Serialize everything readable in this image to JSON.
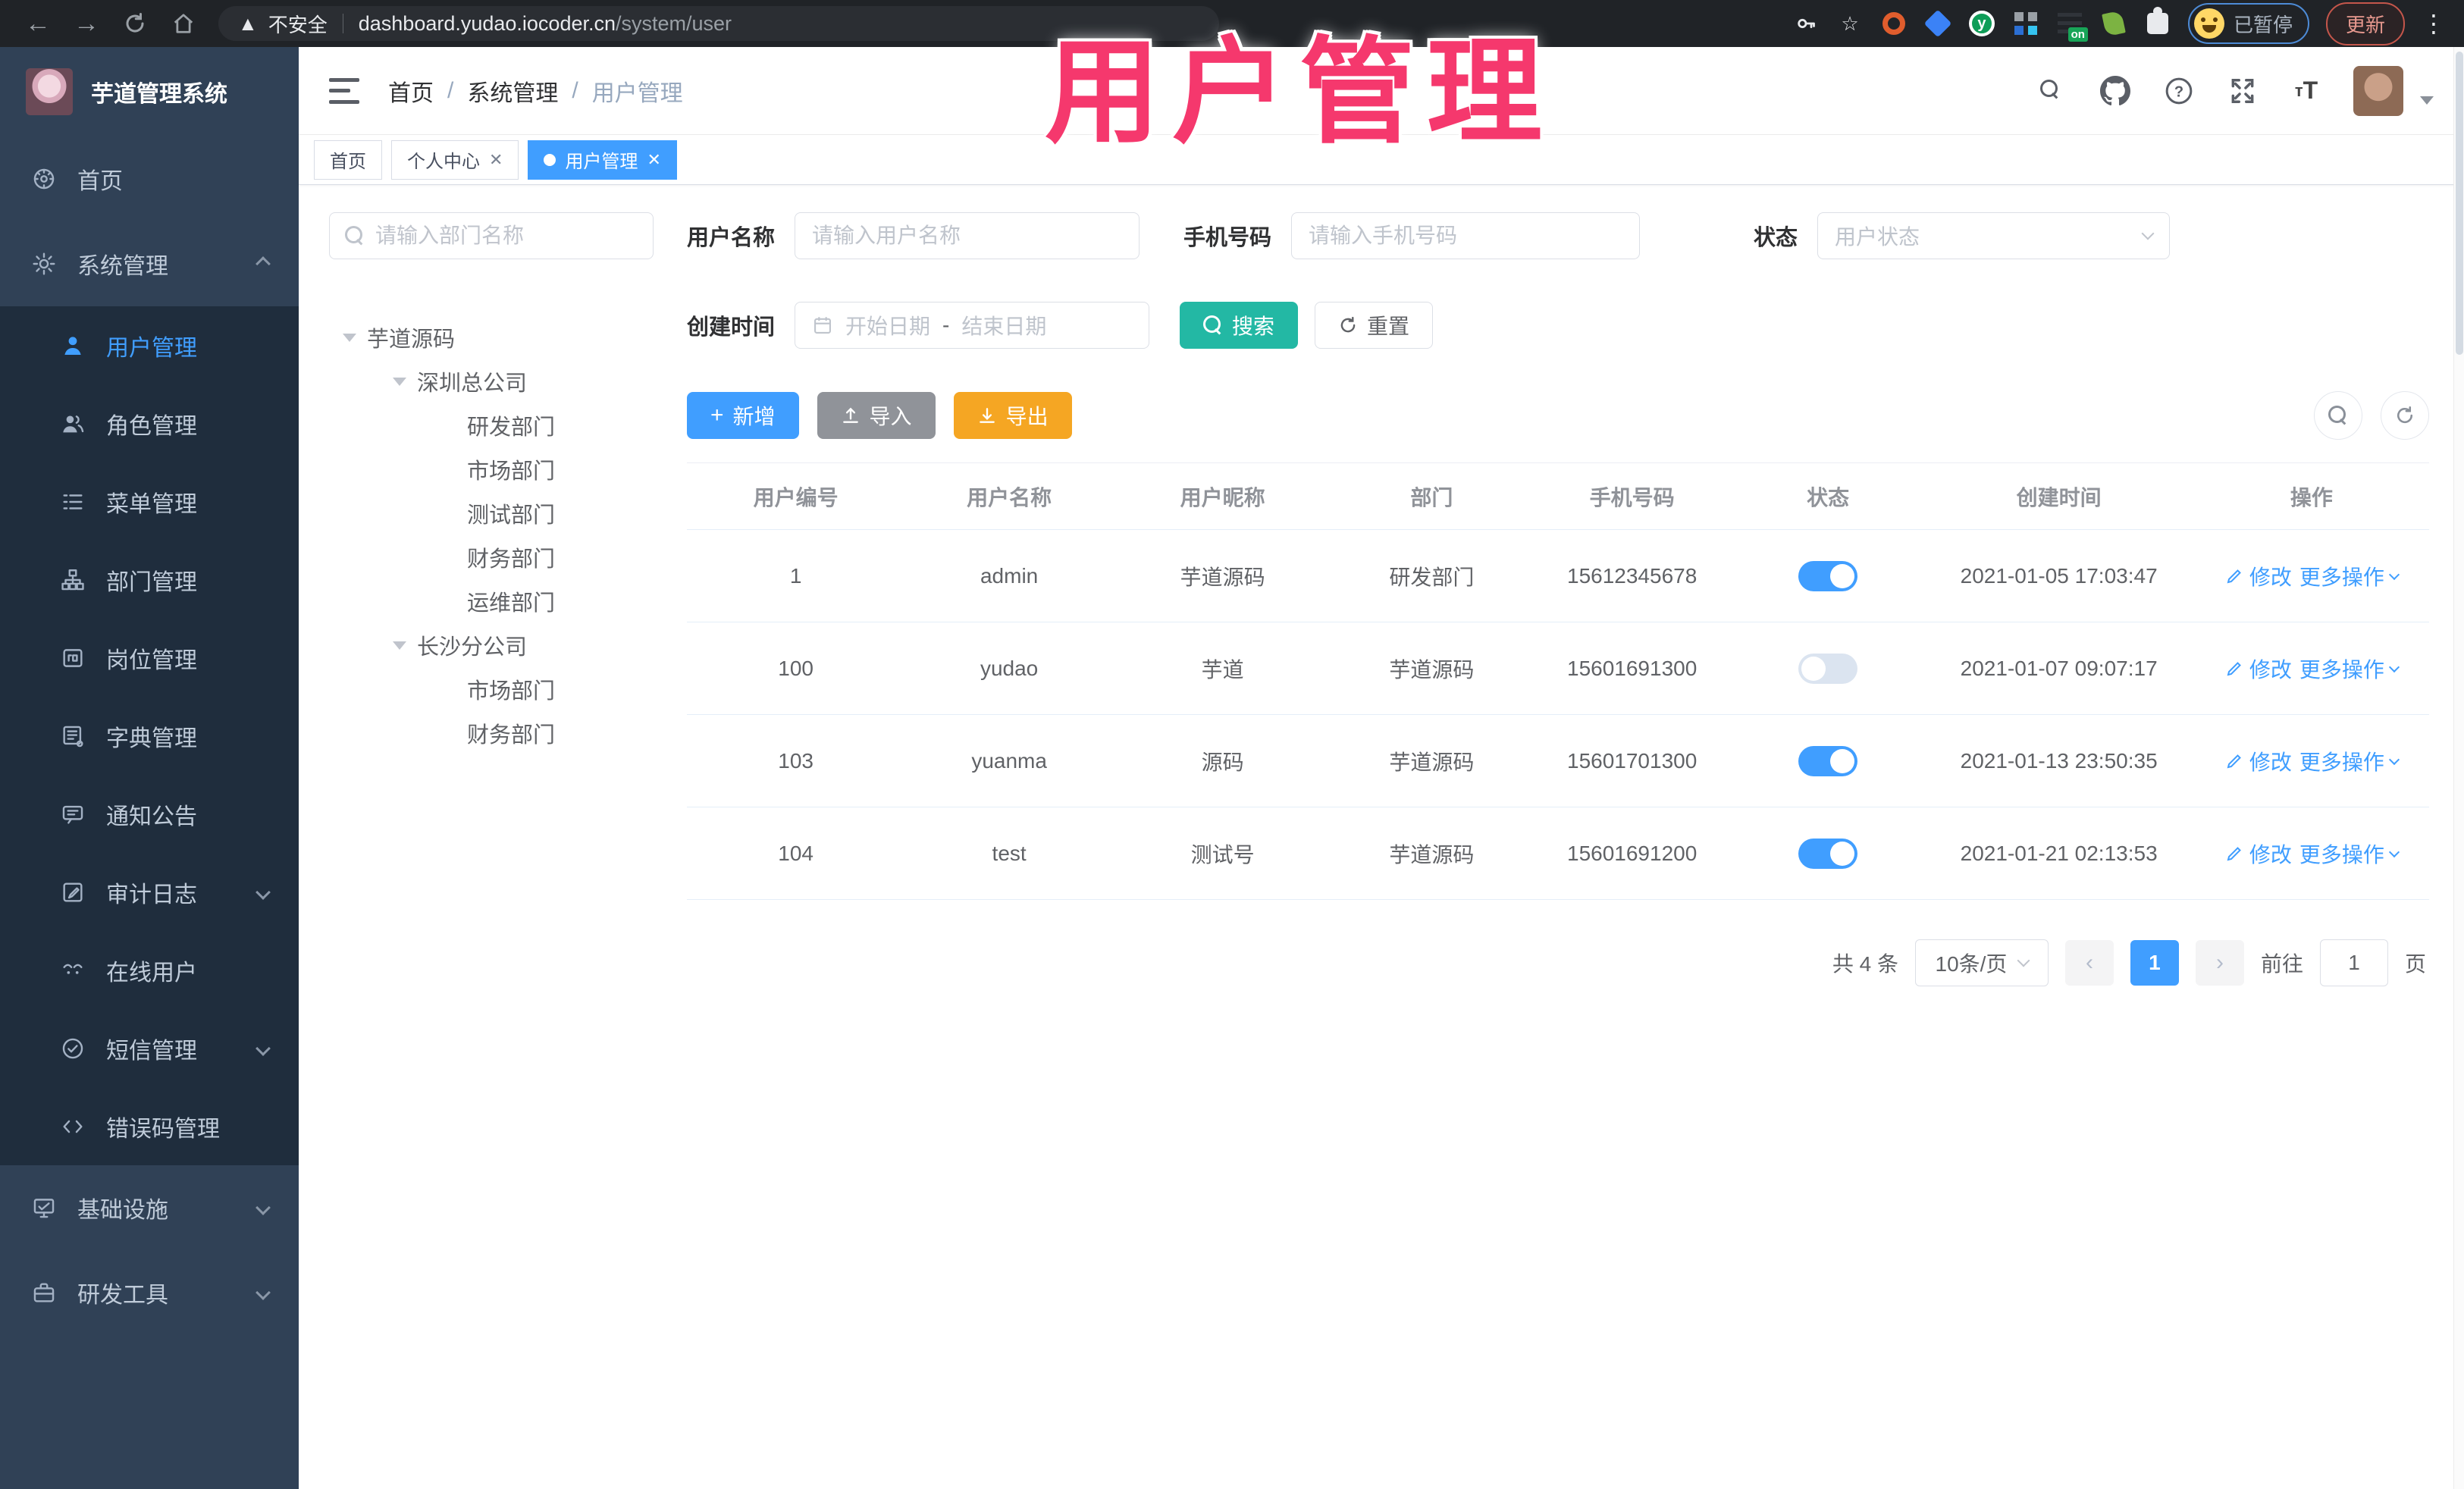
{
  "browser": {
    "security_warning": "不安全",
    "url_host": "dashboard.yudao.iocoder.cn",
    "url_path": "/system/user",
    "profile_status": "已暂停",
    "update_label": "更新"
  },
  "watermark": {
    "text": "用户管理",
    "color": "#f5386d"
  },
  "sidebar": {
    "logo_title": "芋道管理系统",
    "menu": [
      {
        "label": "首页",
        "icon": "dashboard-icon"
      },
      {
        "label": "系统管理",
        "icon": "gear-icon",
        "chevron": "up",
        "children": [
          {
            "label": "用户管理",
            "icon": "user-icon",
            "active": true
          },
          {
            "label": "角色管理",
            "icon": "roles-icon"
          },
          {
            "label": "菜单管理",
            "icon": "menu-list-icon"
          },
          {
            "label": "部门管理",
            "icon": "org-tree-icon"
          },
          {
            "label": "岗位管理",
            "icon": "post-badge-icon"
          },
          {
            "label": "字典管理",
            "icon": "dictionary-icon"
          },
          {
            "label": "通知公告",
            "icon": "announcement-icon"
          },
          {
            "label": "审计日志",
            "icon": "audit-log-icon",
            "chevron": "down"
          },
          {
            "label": "在线用户",
            "icon": "online-user-icon"
          },
          {
            "label": "短信管理",
            "icon": "sms-icon",
            "chevron": "down"
          },
          {
            "label": "错误码管理",
            "icon": "error-code-icon"
          }
        ]
      },
      {
        "label": "基础设施",
        "icon": "infrastructure-icon",
        "chevron": "down"
      },
      {
        "label": "研发工具",
        "icon": "dev-tools-icon",
        "chevron": "down"
      }
    ]
  },
  "header": {
    "breadcrumb": [
      "首页",
      "系统管理",
      "用户管理"
    ]
  },
  "tabs": [
    {
      "label": "首页",
      "closable": false,
      "active": false
    },
    {
      "label": "个人中心",
      "closable": true,
      "active": false
    },
    {
      "label": "用户管理",
      "closable": true,
      "active": true
    }
  ],
  "tree": {
    "search_placeholder": "请输入部门名称",
    "nodes": [
      {
        "label": "芋道源码",
        "level": 0,
        "caret": true
      },
      {
        "label": "深圳总公司",
        "level": 1,
        "caret": true
      },
      {
        "label": "研发部门",
        "level": 2
      },
      {
        "label": "市场部门",
        "level": 2
      },
      {
        "label": "测试部门",
        "level": 2
      },
      {
        "label": "财务部门",
        "level": 2
      },
      {
        "label": "运维部门",
        "level": 2
      },
      {
        "label": "长沙分公司",
        "level": 1,
        "caret": true
      },
      {
        "label": "市场部门",
        "level": 2
      },
      {
        "label": "财务部门",
        "level": 2
      }
    ]
  },
  "filters": {
    "username_label": "用户名称",
    "username_placeholder": "请输入用户名称",
    "mobile_label": "手机号码",
    "mobile_placeholder": "请输入手机号码",
    "status_label": "状态",
    "status_placeholder": "用户状态",
    "create_time_label": "创建时间",
    "date_start_placeholder": "开始日期",
    "date_separator": "-",
    "date_end_placeholder": "结束日期",
    "search_label": "搜索",
    "reset_label": "重置"
  },
  "toolbar": {
    "add_label": "新增",
    "import_label": "导入",
    "export_label": "导出"
  },
  "table": {
    "columns": [
      "用户编号",
      "用户名称",
      "用户昵称",
      "部门",
      "手机号码",
      "状态",
      "创建时间",
      "操作"
    ],
    "action_edit": "修改",
    "action_more": "更多操作",
    "rows": [
      {
        "id": "1",
        "username": "admin",
        "nickname": "芋道源码",
        "dept": "研发部门",
        "mobile": "15612345678",
        "status_on": true,
        "created": "2021-01-05 17:03:47"
      },
      {
        "id": "100",
        "username": "yudao",
        "nickname": "芋道",
        "dept": "芋道源码",
        "mobile": "15601691300",
        "status_on": false,
        "created": "2021-01-07 09:07:17"
      },
      {
        "id": "103",
        "username": "yuanma",
        "nickname": "源码",
        "dept": "芋道源码",
        "mobile": "15601701300",
        "status_on": true,
        "created": "2021-01-13 23:50:35"
      },
      {
        "id": "104",
        "username": "test",
        "nickname": "测试号",
        "dept": "芋道源码",
        "mobile": "15601691200",
        "status_on": true,
        "created": "2021-01-21 02:13:53"
      }
    ]
  },
  "pagination": {
    "total_text": "共 4 条",
    "page_size": "10条/页",
    "prev_label": "‹",
    "next_label": "›",
    "current_page": "1",
    "goto_label": "前往",
    "goto_value": "1",
    "page_unit": "页"
  },
  "colors": {
    "primary": "#409eff",
    "search_button": "#23b8a4",
    "export_button": "#f5a623",
    "import_button": "#909399",
    "watermark": "#f5386d"
  }
}
